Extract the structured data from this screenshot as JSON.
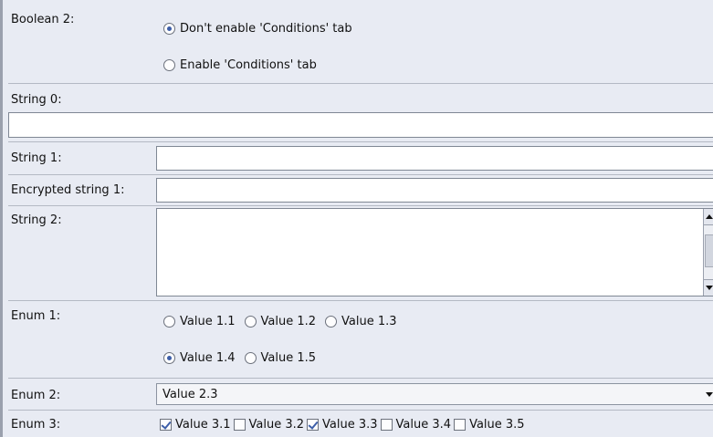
{
  "boolean2": {
    "label": "Boolean 2:",
    "options": [
      {
        "label": "Don't enable 'Conditions' tab",
        "selected": true
      },
      {
        "label": "Enable 'Conditions' tab",
        "selected": false
      }
    ]
  },
  "string0": {
    "label": "String 0:",
    "value": ""
  },
  "string1": {
    "label": "String 1:",
    "value": ""
  },
  "encrypted_string1": {
    "label": "Encrypted string 1:",
    "value": ""
  },
  "string2": {
    "label": "String 2:",
    "value": ""
  },
  "enum1": {
    "label": "Enum 1:",
    "options": [
      {
        "label": "Value 1.1",
        "selected": false
      },
      {
        "label": "Value 1.2",
        "selected": false
      },
      {
        "label": "Value 1.3",
        "selected": false
      },
      {
        "label": "Value 1.4",
        "selected": true
      },
      {
        "label": "Value 1.5",
        "selected": false
      }
    ]
  },
  "enum2": {
    "label": "Enum 2:",
    "selected": "Value 2.3"
  },
  "enum3": {
    "label": "Enum 3:",
    "options": [
      {
        "label": "Value 3.1",
        "checked": true
      },
      {
        "label": "Value 3.2",
        "checked": false
      },
      {
        "label": "Value 3.3",
        "checked": true
      },
      {
        "label": "Value 3.4",
        "checked": false
      },
      {
        "label": "Value 3.5",
        "checked": false
      }
    ]
  },
  "colors": {
    "background": "#e8ebf3",
    "accent": "#3d5ea8",
    "field_border": "#7f8794"
  }
}
